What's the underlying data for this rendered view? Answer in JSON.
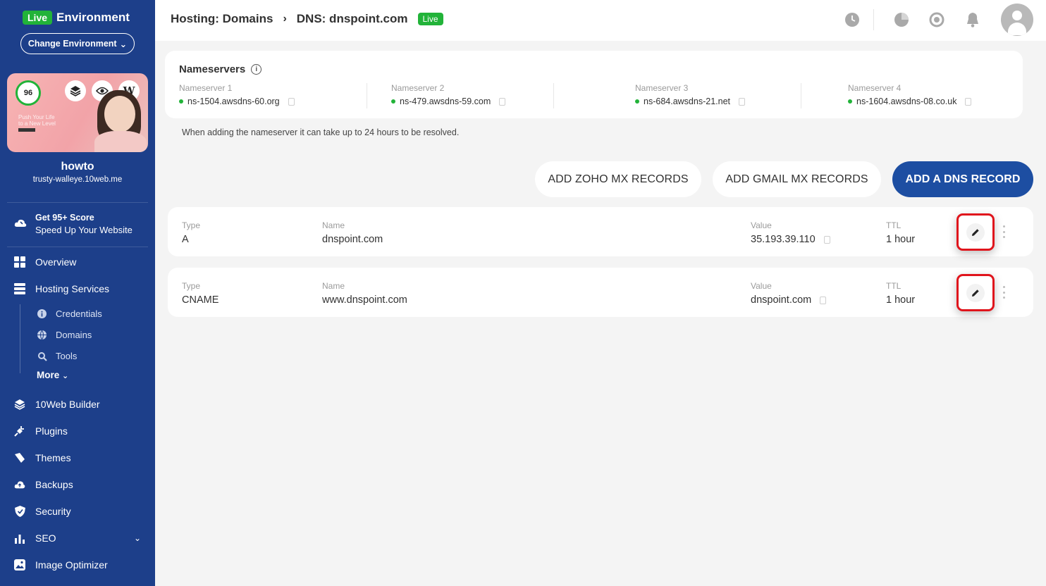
{
  "env": {
    "badge": "Live",
    "title": "Environment",
    "change_label": "Change Environment"
  },
  "site": {
    "score": "96",
    "name": "howto",
    "url": "trusty-walleye.10web.me",
    "preview_text": "Push Your Life\nto a New Level"
  },
  "promo": {
    "title": "Get 95+ Score",
    "subtitle": "Speed Up Your Website"
  },
  "nav": {
    "overview": "Overview",
    "hosting": "Hosting Services",
    "sub": {
      "credentials": "Credentials",
      "domains": "Domains",
      "tools": "Tools"
    },
    "more": "More",
    "builder": "10Web Builder",
    "plugins": "Plugins",
    "themes": "Themes",
    "backups": "Backups",
    "security": "Security",
    "seo": "SEO",
    "image_optimizer": "Image Optimizer"
  },
  "header": {
    "crumb1": "Hosting: Domains",
    "crumb2": "DNS: dnspoint.com",
    "badge": "Live"
  },
  "nameservers": {
    "title": "Nameservers",
    "items": [
      {
        "label": "Nameserver 1",
        "value": "ns-1504.awsdns-60.org"
      },
      {
        "label": "Nameserver 2",
        "value": "ns-479.awsdns-59.com"
      },
      {
        "label": "Nameserver 3",
        "value": "ns-684.awsdns-21.net"
      },
      {
        "label": "Nameserver 4",
        "value": "ns-1604.awsdns-08.co.uk"
      }
    ],
    "note": "When adding the nameserver it can take up to 24 hours to be resolved."
  },
  "actions": {
    "zoho": "ADD ZOHO MX RECORDS",
    "gmail": "ADD GMAIL MX RECORDS",
    "add_dns": "ADD A DNS RECORD"
  },
  "records": [
    {
      "type_label": "Type",
      "type": "A",
      "name_label": "Name",
      "name": "dnspoint.com",
      "value_label": "Value",
      "value": "35.193.39.110",
      "ttl_label": "TTL",
      "ttl": "1 hour"
    },
    {
      "type_label": "Type",
      "type": "CNAME",
      "name_label": "Name",
      "name": "www.dnspoint.com",
      "value_label": "Value",
      "value": "dnspoint.com",
      "ttl_label": "TTL",
      "ttl": "1 hour"
    }
  ],
  "colors": {
    "sidebar": "#1d3f8a",
    "live": "#22b339",
    "primary": "#1d4ea2",
    "highlight": "#e0141c"
  }
}
